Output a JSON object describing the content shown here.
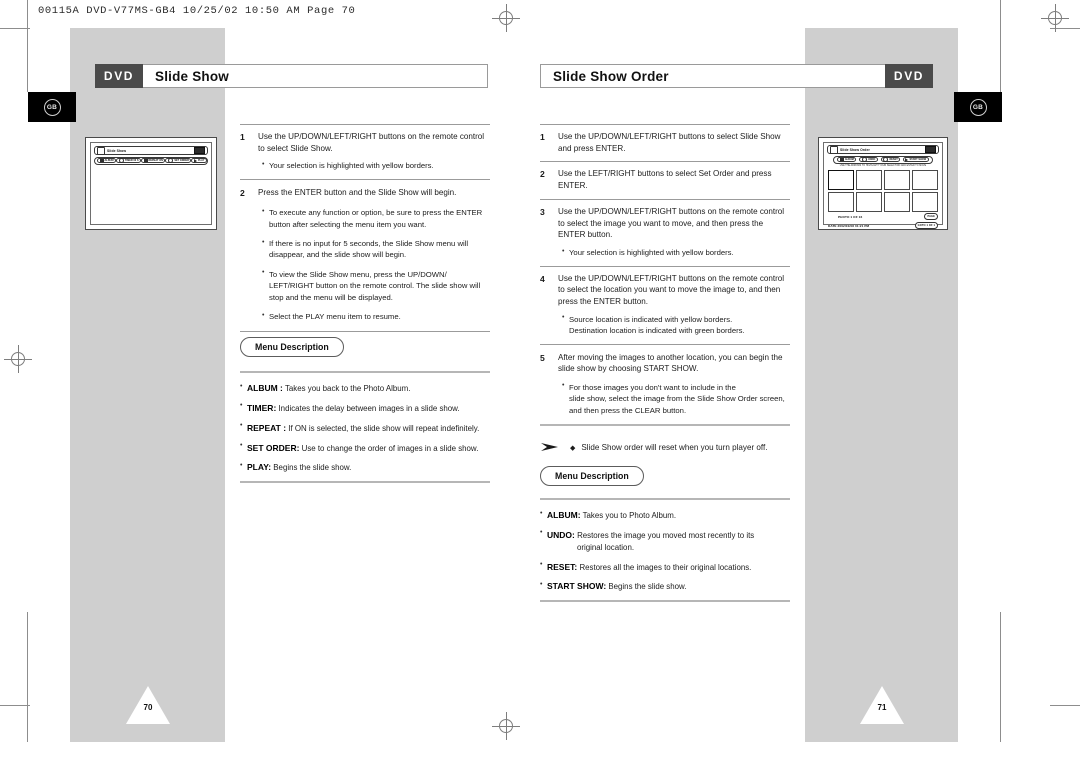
{
  "print_header": "00115A  DVD-V77MS-GB4   10/25/02 10:50 AM   Page 70",
  "region_badge": "GB",
  "left_page": {
    "number": "70",
    "title_tag": "DVD",
    "title": "Slide Show",
    "illustration": {
      "osd_title": "Slide Show",
      "toolbar": [
        {
          "label": "ALBUM",
          "icon": "album-icon"
        },
        {
          "label": "TIMER 06 S",
          "icon": "timer-icon"
        },
        {
          "label": "REPEAT ON",
          "icon": "repeat-icon"
        },
        {
          "label": "SET ORDER",
          "icon": "set-order-icon"
        },
        {
          "label": "PLAY",
          "icon": "play-icon"
        }
      ]
    },
    "steps": [
      {
        "num": "1",
        "text": "Use the UP/DOWN/LEFT/RIGHT buttons on the remote control to select Slide Show.",
        "bullets": [
          "Your selection is highlighted with yellow borders."
        ]
      },
      {
        "num": "2",
        "text": "Press the ENTER button and the Slide Show will begin.",
        "bullets": [
          "To execute any function or option, be sure to press the ENTER button after selecting the menu item you want.",
          "If there is no input for 5 seconds, the Slide Show menu will disappear, and the slide show will begin.",
          "To view the Slide Show menu, press the UP/DOWN/ LEFT/RIGHT button on the remote control. The slide show will stop and the menu will be displayed.",
          "Select the PLAY menu item to resume."
        ]
      }
    ],
    "menu_description": {
      "heading": "Menu Description",
      "items": [
        {
          "term": "ALBUM :",
          "desc": "Takes you back to the Photo Album."
        },
        {
          "term": "TIMER:",
          "desc": "Indicates the delay between images in a slide show."
        },
        {
          "term": "REPEAT :",
          "desc": "If ON is selected, the slide show will repeat indefinitely."
        },
        {
          "term": "SET ORDER:",
          "desc": "Use to change the order of images in a slide show."
        },
        {
          "term": "PLAY:",
          "desc": "Begins the slide show."
        }
      ]
    }
  },
  "right_page": {
    "number": "71",
    "title_tag": "DVD",
    "title": "Slide Show Order",
    "illustration": {
      "osd_title": "Slide Show Order",
      "toolbar": [
        {
          "label": "ALBUM",
          "icon": "album-icon"
        },
        {
          "label": "UNDO",
          "icon": "undo-icon"
        },
        {
          "label": "RESET",
          "icon": "reset-icon"
        },
        {
          "label": "START SHOW",
          "icon": "play-icon"
        }
      ],
      "hint": "USE THE ARROWS TO HIGHLIGHT YOUR SELECTION AND ENTER TO MOVE",
      "photo_status": "PHOTO   1 OF  16",
      "date_status": "DATE  2002/01/08   01:21 PM",
      "page_pill": "PAGE",
      "goto_pill": "GOTO    1 OF 1"
    },
    "steps": [
      {
        "num": "1",
        "text": "Use the UP/DOWN/LEFT/RIGHT buttons to select Slide Show and press ENTER.",
        "bullets": []
      },
      {
        "num": "2",
        "text": "Use the LEFT/RIGHT buttons to select Set Order and press ENTER.",
        "bullets": []
      },
      {
        "num": "3",
        "text": "Use the UP/DOWN/LEFT/RIGHT buttons on the remote control to select the image you want to move, and then press the ENTER button.",
        "bullets": [
          "Your selection is highlighted with yellow borders."
        ]
      },
      {
        "num": "4",
        "text": "Use the UP/DOWN/LEFT/RIGHT buttons on the remote control to select the location you want to move the image to, and then press the ENTER button.",
        "bullets": [
          "Source location is indicated with yellow borders.||Destination location is indicated with green borders."
        ]
      },
      {
        "num": "5",
        "text": "After moving the images to another location, you can begin the slide show by choosing START SHOW.",
        "bullets": [
          "For those images you don't want to include in the||slide show, select the image from the Slide Show Order screen,||and then press the CLEAR button."
        ]
      }
    ],
    "note": "Slide Show order will reset when you turn player off.",
    "menu_description": {
      "heading": "Menu Description",
      "items": [
        {
          "term": "ALBUM:",
          "desc": "Takes you to Photo Album."
        },
        {
          "term": "UNDO:",
          "desc": "Restores the image you moved most recently to its",
          "cont": "original location."
        },
        {
          "term": "RESET:",
          "desc": "Restores all the images to their original locations."
        },
        {
          "term": "START SHOW:",
          "desc": "Begins the slide show."
        }
      ]
    }
  },
  "colors": {
    "plate_gray": "#cfcfcf",
    "tag_dark": "#4a4a4a",
    "rule_gray": "#9b9b9b"
  }
}
